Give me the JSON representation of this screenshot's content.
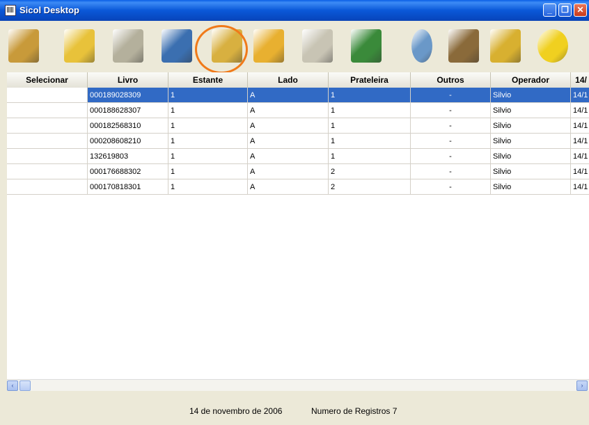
{
  "window": {
    "title": "Sicol Desktop",
    "min_glyph": "_",
    "max_glyph": "❐",
    "close_glyph": "✕"
  },
  "toolbar": {
    "buttons": [
      {
        "icon": "open-document-icon",
        "color": "#c89a3a"
      },
      {
        "icon": "cancel-icon",
        "color": "#e8c23a"
      },
      {
        "icon": "blank-icon",
        "color": "#b4b09c"
      },
      {
        "icon": "list-view-icon",
        "color": "#3b6fb0"
      },
      {
        "icon": "book-folder-icon",
        "color": "#d8b040"
      },
      {
        "icon": "user-edit-icon",
        "color": "#e8b030"
      },
      {
        "icon": "disabled-bin-icon",
        "color": "#c8c4b4"
      },
      {
        "icon": "report-printer-icon",
        "color": "#3a8a3a"
      },
      {
        "icon": "user-icon",
        "color": "#6a98c8"
      },
      {
        "icon": "books-icon",
        "color": "#8a6a3a"
      },
      {
        "icon": "clock-edit-icon",
        "color": "#d8b030"
      },
      {
        "icon": "exit-door-icon",
        "color": "#f0d020"
      }
    ],
    "highlight_color": "#f07a1a"
  },
  "table": {
    "columns": [
      "Selecionar",
      "Livro",
      "Estante",
      "Lado",
      "Prateleira",
      "Outros",
      "Operador",
      "14/"
    ],
    "rows": [
      [
        "",
        "000189028309",
        "1",
        "A",
        "1",
        "-",
        "Silvio",
        "14/1"
      ],
      [
        "",
        "000188628307",
        "1",
        "A",
        "1",
        "-",
        "Silvio",
        "14/1"
      ],
      [
        "",
        "000182568310",
        "1",
        "A",
        "1",
        "-",
        "Silvio",
        "14/1"
      ],
      [
        "",
        "000208608210",
        "1",
        "A",
        "1",
        "-",
        "Silvio",
        "14/1"
      ],
      [
        "",
        "132619803",
        "1",
        "A",
        "1",
        "-",
        "Silvio",
        "14/1"
      ],
      [
        "",
        "000176688302",
        "1",
        "A",
        "2",
        "-",
        "Silvio",
        "14/1"
      ],
      [
        "",
        "000170818301",
        "1",
        "A",
        "2",
        "-",
        "Silvio",
        "14/1"
      ]
    ],
    "selected_row": 0,
    "selection_color": "#316ac5"
  },
  "scrollbar": {
    "left_glyph": "‹",
    "right_glyph": "›"
  },
  "status": {
    "date": "14 de novembro de 2006",
    "records": "Numero de Registros 7"
  }
}
